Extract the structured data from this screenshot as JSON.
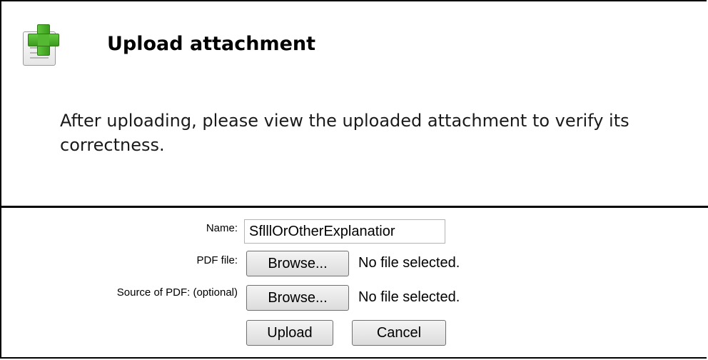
{
  "dialog": {
    "title": "Upload attachment",
    "icon": "document-add-icon",
    "message": "After uploading, please view the uploaded attachment to verify its correctness."
  },
  "form": {
    "name_label": "Name:",
    "name_value": "SflllOrOtherExplanatior",
    "pdf_label": "PDF file:",
    "pdf_browse_label": "Browse...",
    "pdf_status": "No file selected.",
    "source_label": "Source of PDF: (optional)",
    "source_browse_label": "Browse...",
    "source_status": "No file selected.",
    "upload_label": "Upload",
    "cancel_label": "Cancel"
  },
  "colors": {
    "plus_green": "#3c9a1e",
    "border": "#000000"
  }
}
